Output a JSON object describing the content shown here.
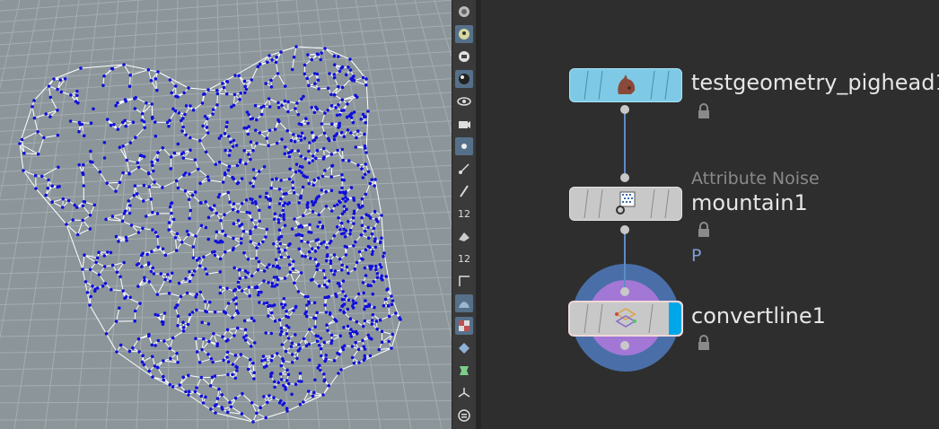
{
  "colors": {
    "viewport_bg": "#8c969a",
    "grid_line": "#a4adb1",
    "wire": "#ffffff",
    "points": "#1010d8",
    "network_bg": "#2e2e2e",
    "toolbar_active": "#56708a",
    "node_gray": "#c8c8c8",
    "node_blue": "#7ecae6",
    "display_flag": "#00a7e8",
    "ring_blue": "#4a6fa8",
    "ring_purple": "#a377d6",
    "label_text": "#e6e6e6",
    "type_text": "#8a8a8a",
    "flag_text": "#7f9fd6"
  },
  "viewport": {
    "geometry": "wireframe-mesh-with-points"
  },
  "toolbar": {
    "items": [
      {
        "name": "selection-mode-icon"
      },
      {
        "name": "show-points-icon"
      },
      {
        "name": "display-options-icon"
      },
      {
        "name": "shading-icon"
      },
      {
        "name": "view-tool-icon"
      },
      {
        "name": "camera-tool-icon"
      },
      {
        "name": "point-display-icon"
      },
      {
        "name": "normal-display-icon"
      },
      {
        "name": "pen-tool-icon"
      },
      {
        "name": "point-numbers-icon",
        "text": "12"
      },
      {
        "name": "prim-tool-icon"
      },
      {
        "name": "prim-numbers-icon",
        "text": "12"
      },
      {
        "name": "edge-tool-icon"
      },
      {
        "name": "smooth-shading-icon"
      },
      {
        "name": "texture-display-icon"
      },
      {
        "name": "grid-display-icon"
      },
      {
        "name": "ghost-display-icon"
      },
      {
        "name": "axis-tool-icon"
      },
      {
        "name": "menu-icon"
      }
    ]
  },
  "network": {
    "nodes": [
      {
        "name": "testgeometry_pighead1",
        "type": "",
        "flag": ""
      },
      {
        "name": "mountain1",
        "type": "Attribute Noise",
        "flag": "P"
      },
      {
        "name": "convertline1",
        "type": "",
        "flag": ""
      }
    ]
  }
}
